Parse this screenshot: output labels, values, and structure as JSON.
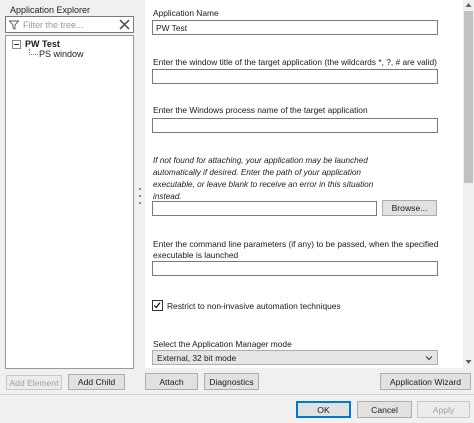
{
  "explorer": {
    "title": "Application Explorer",
    "filter_placeholder": "Filter the tree...",
    "tree_root": "PW Test",
    "tree_child": "PS window"
  },
  "form": {
    "app_name_label": "Application Name",
    "app_name_value": "PW Test",
    "window_title_label": "Enter the window title of the target application (the wildcards *, ?, # are valid)",
    "window_title_value": "",
    "process_label": "Enter the Windows process name of the target application",
    "process_value": "",
    "launch_note": "If not found for attaching, your application may be launched automatically if desired. Enter the path of your application executable, or leave blank to receive an error in this situation instead.",
    "exe_path_value": "",
    "browse_label": "Browse...",
    "cmdline_label": "Enter the command line parameters (if any) to be passed, when the specified executable is launched",
    "cmdline_value": "",
    "restrict_label": "Restrict to non-invasive automation techniques",
    "restrict_checked": true,
    "mode_label": "Select the Application Manager mode",
    "mode_value": "External, 32 bit mode"
  },
  "toolbar": {
    "add_element": "Add Element",
    "add_child": "Add Child",
    "attach": "Attach",
    "diagnostics": "Diagnostics",
    "wizard": "Application Wizard"
  },
  "dialog": {
    "ok": "OK",
    "cancel": "Cancel",
    "apply": "Apply"
  },
  "icons": {
    "filter": "funnel-icon",
    "clear": "close-icon",
    "check": "check-icon",
    "dropdown": "chevron-down-icon"
  }
}
